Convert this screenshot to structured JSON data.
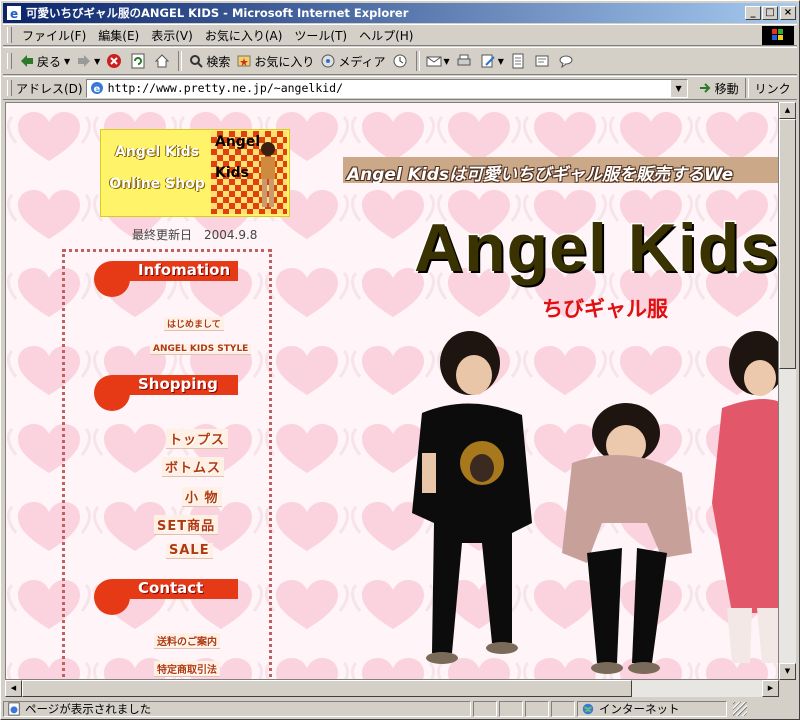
{
  "window": {
    "title": "可愛いちびギャル服のANGEL KIDS - Microsoft Internet Explorer",
    "minimize": "_",
    "maximize": "□",
    "close": "×"
  },
  "menu": [
    "ファイル(F)",
    "編集(E)",
    "表示(V)",
    "お気に入り(A)",
    "ツール(T)",
    "ヘルプ(H)"
  ],
  "toolbar": {
    "back": "戻る",
    "search": "検索",
    "favorites": "お気に入り",
    "media": "メディア"
  },
  "address": {
    "label": "アドレス(D)",
    "url": "http://www.pretty.ne.jp/~angelkid/",
    "go": "移動",
    "links": "リンク"
  },
  "page": {
    "logo_line1": "Angel Kids",
    "logo_line2": "Online Shop",
    "logo_img_line1": "Angel",
    "logo_img_line2": "Kids",
    "updated": "最終更新日　2004.9.8",
    "sections": [
      {
        "title": "Infomation",
        "links": [
          "はじめまして",
          "ANGEL KIDS STYLE"
        ]
      },
      {
        "title": "Shopping",
        "links": [
          "トップス",
          "ボトムス",
          "小 物",
          "SET商品",
          "SALE"
        ]
      },
      {
        "title": "Contact",
        "links": [
          "送料のご案内",
          "特定商取引法"
        ]
      }
    ],
    "banner": "Angel Kidsは可愛いちびギャル服を販売するWe",
    "title": "Angel Kids",
    "subtitle": "ちびギャル服"
  },
  "status": {
    "text": "ページが表示されました",
    "zone": "インターネット"
  },
  "colors": {
    "titlebar": "#0a246a",
    "accent": "#e63a16",
    "page_bg": "#fff3f6"
  }
}
